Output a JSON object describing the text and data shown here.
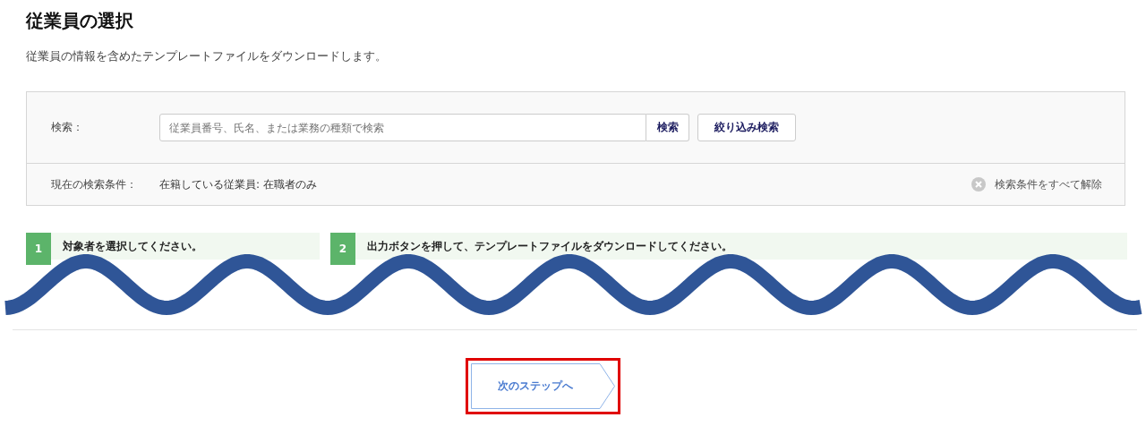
{
  "title": "従業員の選択",
  "description": "従業員の情報を含めたテンプレートファイルをダウンロードします。",
  "search": {
    "label": "検索：",
    "placeholder": "従業員番号、氏名、または業務の種類で検索",
    "search_button": "検索",
    "filter_button": "絞り込み検索"
  },
  "conditions": {
    "label": "現在の検索条件：",
    "value": "在籍している従業員: 在職者のみ",
    "clear_label": "検索条件をすべて解除"
  },
  "steps": [
    {
      "number": "1",
      "text": "対象者を選択してください。"
    },
    {
      "number": "2",
      "text": "出力ボタンを押して、テンプレートファイルをダウンロードしてください。"
    }
  ],
  "next_button": {
    "label": "次のステップへ",
    "highlighted": true
  }
}
